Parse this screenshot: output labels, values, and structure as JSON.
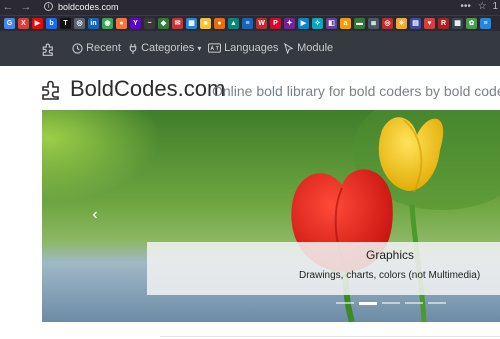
{
  "browser": {
    "url": "boldcodes.com",
    "back_glyph": "←",
    "forward_glyph": "→",
    "info_glyph": "i",
    "menu_glyph": "•••",
    "extra_glyph": "☆",
    "profile_glyph": "1"
  },
  "bookmarks": [
    {
      "icon": "google-icon",
      "glyph": "G",
      "color": "#ffffff",
      "bg": "#4285f4"
    },
    {
      "icon": "red-x-icon",
      "glyph": "X",
      "color": "#ffffff",
      "bg": "#e53935"
    },
    {
      "icon": "youtube-icon",
      "glyph": "▶",
      "color": "#ffffff",
      "bg": "#ff0000"
    },
    {
      "icon": "behance-icon",
      "glyph": "b",
      "color": "#ffffff",
      "bg": "#1769ff"
    },
    {
      "icon": "b-bookmark-icon",
      "glyph": "T",
      "color": "#ffffff",
      "bg": "#111111"
    },
    {
      "icon": "globe-icon",
      "glyph": "◎",
      "color": "#ffffff",
      "bg": "#5a6470"
    },
    {
      "icon": "linkedin-icon",
      "glyph": "in",
      "color": "#ffffff",
      "bg": "#0a66c2"
    },
    {
      "icon": "chrome-icon",
      "glyph": "◉",
      "color": "#ffffff",
      "bg": "#34a853"
    },
    {
      "icon": "firefox-icon",
      "glyph": "●",
      "color": "#ffffff",
      "bg": "#ff7139"
    },
    {
      "icon": "yahoo-icon",
      "glyph": "Y",
      "color": "#ffffff",
      "bg": "#6001d2"
    },
    {
      "icon": "wave-icon",
      "glyph": "~",
      "color": "#ffffff",
      "bg": "#3a3a3a"
    },
    {
      "icon": "photos-icon",
      "glyph": "◆",
      "color": "#ffffff",
      "bg": "#2e7d32"
    },
    {
      "icon": "mail-icon",
      "glyph": "✉",
      "color": "#ffffff",
      "bg": "#d32f2f"
    },
    {
      "icon": "grid-icon",
      "glyph": "▦",
      "color": "#ffffff",
      "bg": "#1e88e5"
    },
    {
      "icon": "square-icon",
      "glyph": "■",
      "color": "#ffffff",
      "bg": "#fbc02d"
    },
    {
      "icon": "orange-circle-icon",
      "glyph": "●",
      "color": "#ffffff",
      "bg": "#ef6c00"
    },
    {
      "icon": "landscape-icon",
      "glyph": "▲",
      "color": "#ffffff",
      "bg": "#00897b"
    },
    {
      "icon": "chart-icon",
      "glyph": "≡",
      "color": "#ffffff",
      "bg": "#1565c0"
    },
    {
      "icon": "wp-icon",
      "glyph": "W",
      "color": "#ffffff",
      "bg": "#c62828"
    },
    {
      "icon": "pinterest-icon",
      "glyph": "P",
      "color": "#ffffff",
      "bg": "#e60023"
    },
    {
      "icon": "bird-icon",
      "glyph": "✦",
      "color": "#ffffff",
      "bg": "#7b1fa2"
    },
    {
      "icon": "play-icon",
      "glyph": "▶",
      "color": "#ffffff",
      "bg": "#0288d1"
    },
    {
      "icon": "sparkle-icon",
      "glyph": "✧",
      "color": "#ffffff",
      "bg": "#00acc1"
    },
    {
      "icon": "twitch-icon",
      "glyph": "◧",
      "color": "#ffffff",
      "bg": "#6441a5"
    },
    {
      "icon": "amazon-icon",
      "glyph": "a",
      "color": "#ffffff",
      "bg": "#ff9900"
    },
    {
      "icon": "flag-icon",
      "glyph": "▬",
      "color": "#ffffff",
      "bg": "#2e7d32"
    },
    {
      "icon": "stripes-icon",
      "glyph": "≣",
      "color": "#ffffff",
      "bg": "#455a64"
    },
    {
      "icon": "target-icon",
      "glyph": "◎",
      "color": "#ffffff",
      "bg": "#c62828"
    },
    {
      "icon": "walmart-icon",
      "glyph": "✳",
      "color": "#ffffff",
      "bg": "#f9a825"
    },
    {
      "icon": "layers-icon",
      "glyph": "▤",
      "color": "#ffffff",
      "bg": "#3949ab"
    },
    {
      "icon": "heart-icon",
      "glyph": "♥",
      "color": "#ffffff",
      "bg": "#e53935"
    },
    {
      "icon": "r-icon",
      "glyph": "R",
      "color": "#ffffff",
      "bg": "#b71c1c"
    },
    {
      "icon": "apps-icon",
      "glyph": "▦",
      "color": "#ffffff",
      "bg": "#37474f"
    },
    {
      "icon": "leaf-icon",
      "glyph": "✿",
      "color": "#ffffff",
      "bg": "#43a047"
    },
    {
      "icon": "stack-icon",
      "glyph": "≡",
      "color": "#ffffff",
      "bg": "#1e88e5"
    }
  ],
  "site_nav": {
    "recent": "Recent",
    "categories": "Categories",
    "categories_caret": "▾",
    "languages": "Languages",
    "module": "Module"
  },
  "brand": {
    "name": "BoldCodes.com",
    "tagline": "Online bold library for bold coders by bold coders"
  },
  "carousel": {
    "prev_glyph": "‹",
    "caption_title": "Graphics",
    "caption_text": "Drawings, charts, colors (not Multimedia)",
    "slide_count": 5,
    "active_index": 1
  }
}
